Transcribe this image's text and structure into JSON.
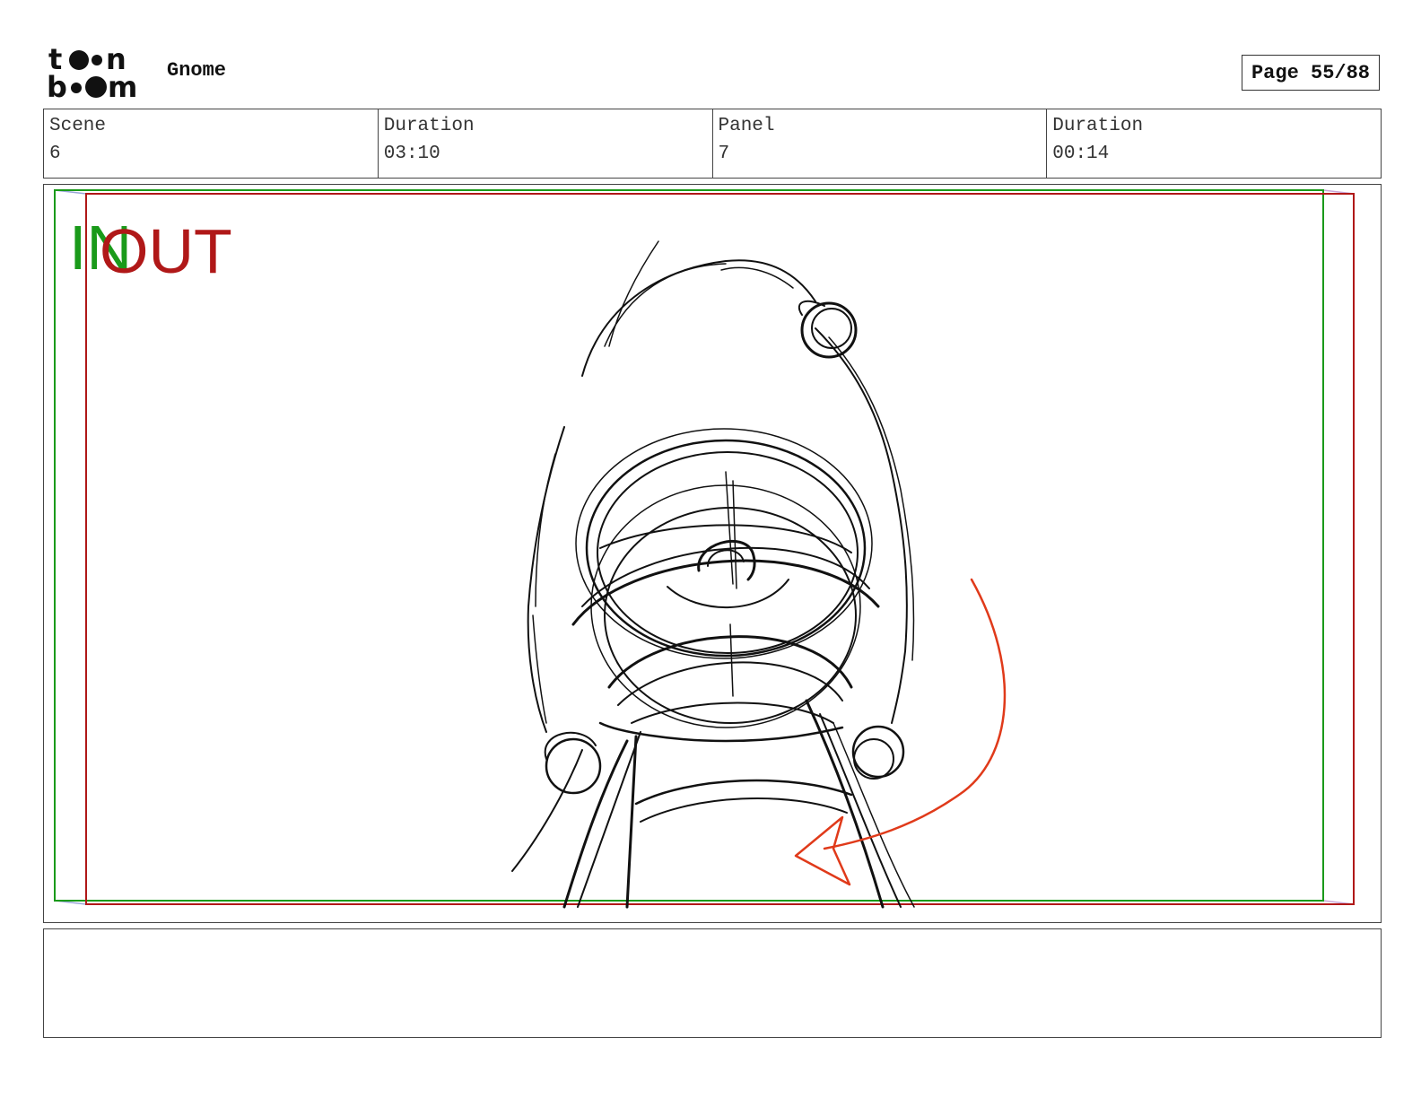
{
  "header": {
    "logo_text": "toon boom",
    "project_title": "Gnome",
    "page_label": "Page 55/88"
  },
  "info": {
    "scene_label": "Scene",
    "scene_value": "6",
    "scene_duration_label": "Duration",
    "scene_duration_value": "03:10",
    "panel_label": "Panel",
    "panel_value": "7",
    "panel_duration_label": "Duration",
    "panel_duration_value": "00:14"
  },
  "panel": {
    "in_marker": "IN",
    "out_marker": "OUT",
    "in_color": "#1a9a1a",
    "out_color": "#b01818",
    "arrow_color": "#e03a1a",
    "sketch_color": "#111111",
    "drawing": "sketch of gnome face looking up in pointed hood with camera motion arrow"
  },
  "notes": {
    "text": ""
  }
}
